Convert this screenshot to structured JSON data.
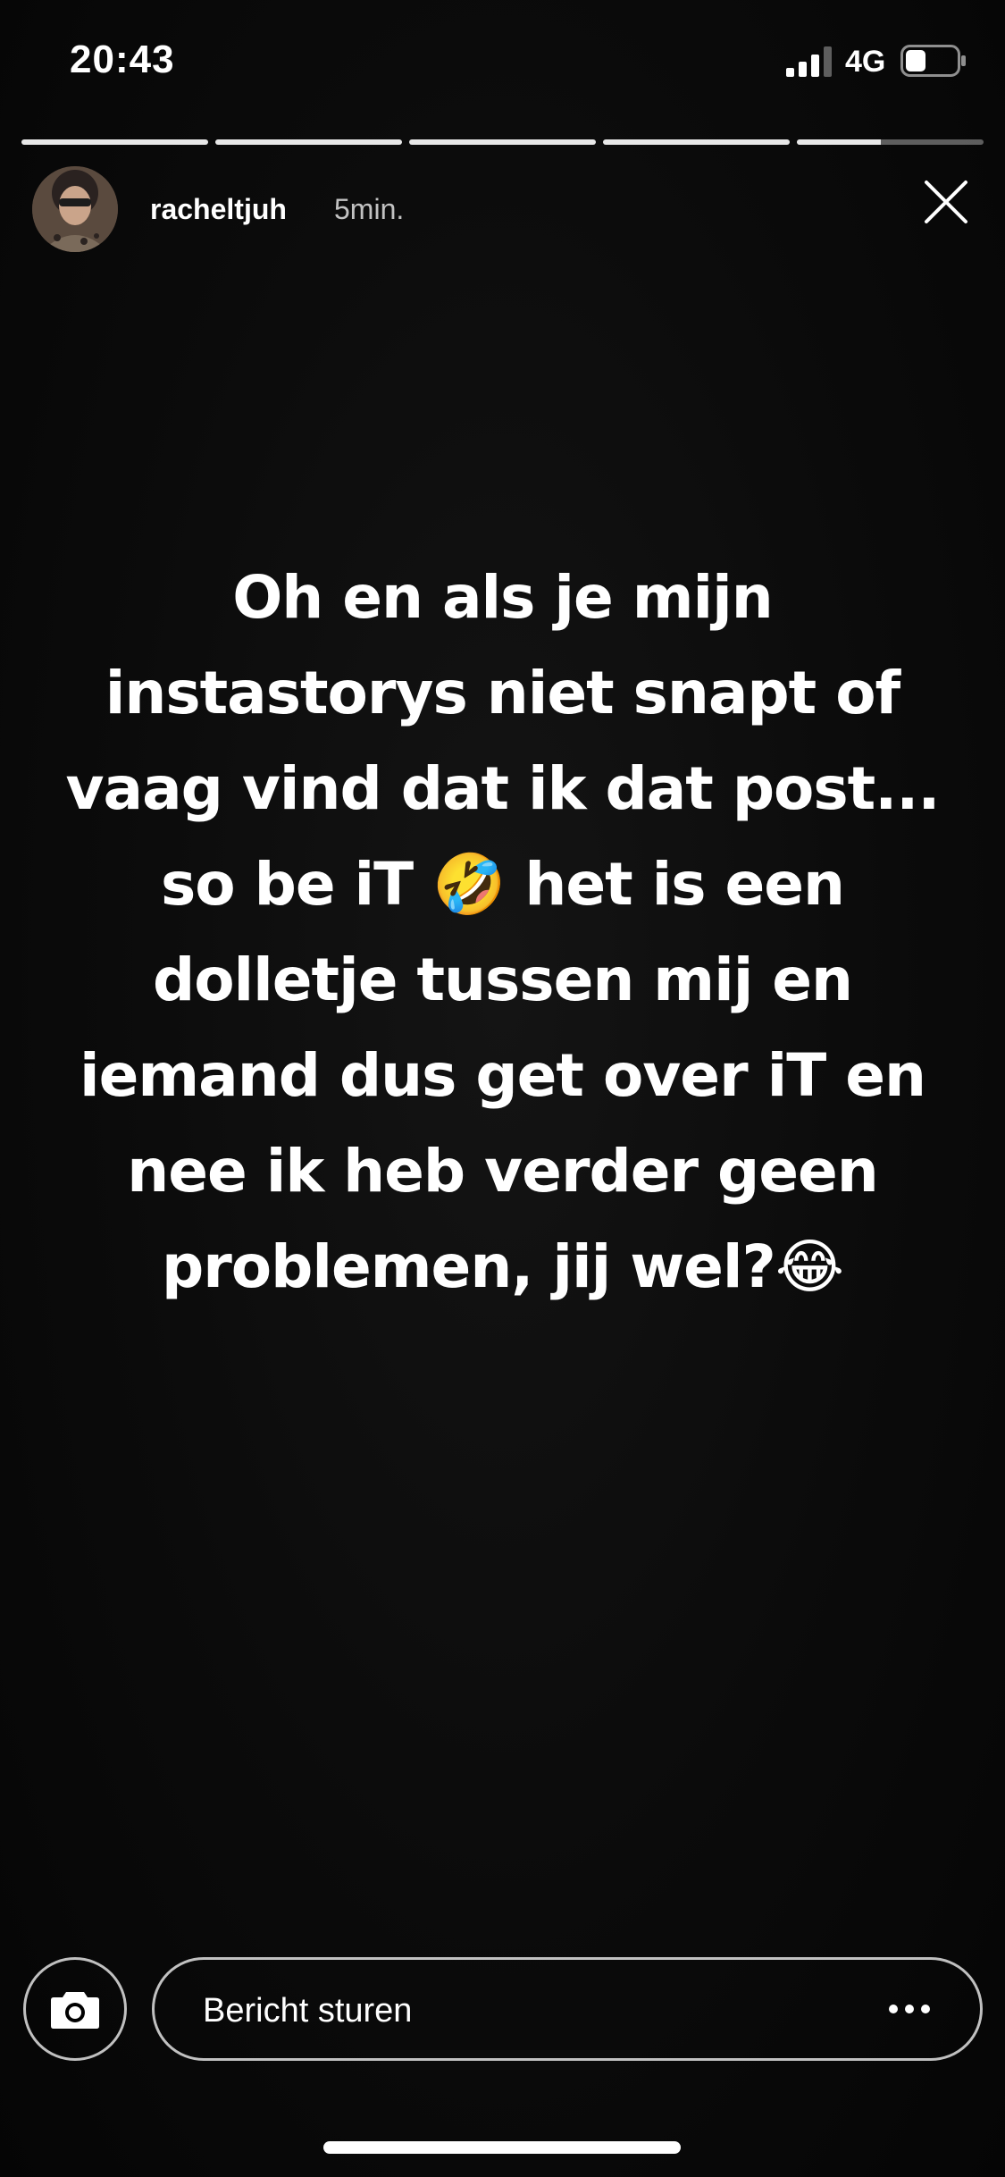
{
  "status_bar": {
    "time": "20:43",
    "network": "4G",
    "signal_bars_active": 3,
    "signal_bars_total": 4,
    "battery_level": 0.35
  },
  "story": {
    "segments_total": 5,
    "current_segment_index": 4,
    "current_segment_progress": 0.45,
    "username": "racheltjuh",
    "time_ago": "5min.",
    "text": "Oh en als je mijn\ninstastorys niet snapt of\nvaag vind dat ik dat post...\nso be iT 🤣 het is een\ndolletje tussen mij en\niemand dus get over iT en\nnee ik heb verder geen\nproblemen, jij wel?😂"
  },
  "footer": {
    "message_placeholder": "Bericht sturen",
    "camera_icon": "camera-icon",
    "more_icon": "more-icon"
  },
  "colors": {
    "background": "#000000",
    "text": "#ffffff",
    "progress_track": "#595959",
    "progress_fill": "#e8e8e8"
  }
}
